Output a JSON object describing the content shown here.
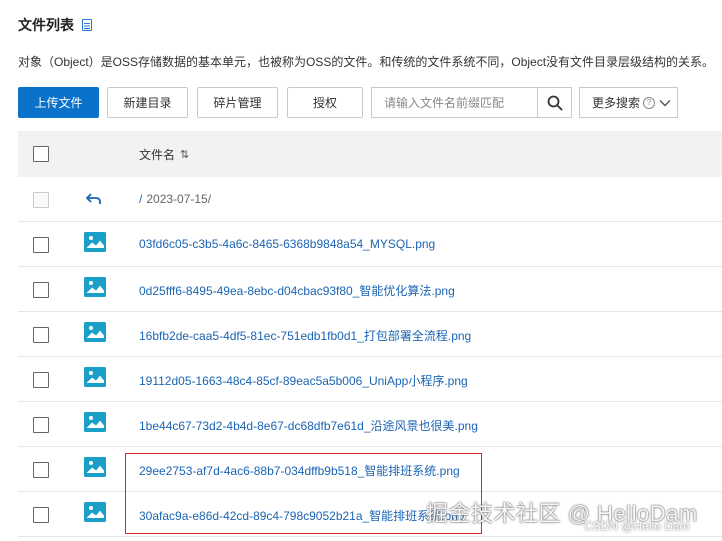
{
  "header": {
    "title": "文件列表",
    "description": "对象（Object）是OSS存储数据的基本单元，也被称为OSS的文件。和传统的文件系统不同，Object没有文件目录层级结构的关系。"
  },
  "toolbar": {
    "upload_label": "上传文件",
    "new_folder_label": "新建目录",
    "fragments_label": "碎片管理",
    "authorize_label": "授权",
    "search_placeholder": "请输入文件名前缀匹配",
    "more_search_label": "更多搜索"
  },
  "table": {
    "column_name": "文件名",
    "parent_row": {
      "slash": "/",
      "path": "2023-07-15/"
    },
    "files": [
      "03fd6c05-c3b5-4a6c-8465-6368b9848a54_MYSQL.png",
      "0d25fff6-8495-49ea-8ebc-d04cbac93f80_智能优化算法.png",
      "16bfb2de-caa5-4df5-81ec-751edb1fb0d1_打包部署全流程.png",
      "19112d05-1663-48c4-85cf-89eac5a5b006_UniApp小程序.png",
      "1be44c67-73d2-4b4d-8e67-dc68dfb7e61d_沿途风景也很美.png",
      "29ee2753-af7d-4ac6-88b7-034dffb9b518_智能排班系统.png",
      "30afac9a-e86d-42cd-89c4-798c9052b21a_智能排班系统.png"
    ]
  },
  "watermark": {
    "main": "掘金技术社区 @ HelloDam",
    "sub": "CSDN @Hello Dam"
  },
  "colors": {
    "primary": "#0a72c9",
    "link": "#1b64b4",
    "highlight": "#d62828",
    "header_bg": "#f1f2f4",
    "icon_teal": "#1aa0c8"
  }
}
